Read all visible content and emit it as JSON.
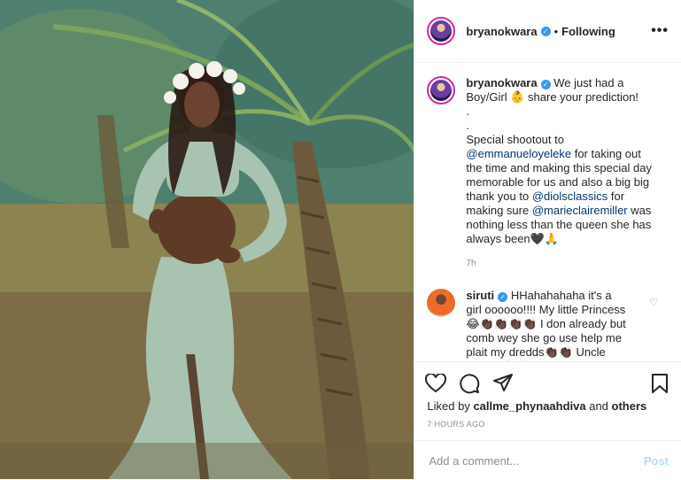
{
  "header": {
    "username": "bryanokwara",
    "separator": "•",
    "follow_state": "Following",
    "more": "•••"
  },
  "caption": {
    "username": "bryanokwara",
    "line1": "We just had a Boy/Girl 👶 share your prediction!",
    "dots": ".",
    "dots2": ".",
    "text_a": "Special shootout to ",
    "mention1": "@emmanueloyeleke",
    "text_b": " for taking out the time and making this special day memorable for us and also a big big thank you to ",
    "mention2": "@diolsclassics",
    "text_c": " for making sure ",
    "mention3": "@marieclairemiller",
    "text_d": " was nothing less than the queen she has always been🖤🙏",
    "time": "7h"
  },
  "comment": {
    "username": "siruti",
    "text": "HHahahahaha it's a girl oooooo!!!! My little Princess😂👏🏿👏🏿👏🏿👏🏿 I don already but comb wey she go use help me plait my dredds👏🏿👏🏿 Uncle Utiiiiiiii👏🏿👏🏿"
  },
  "likes": {
    "prefix": "Liked by ",
    "user": "callme_phynaahdiva",
    "and": " and ",
    "others": "others"
  },
  "posted_ago": "7 HOURS AGO",
  "comment_box": {
    "placeholder": "Add a comment...",
    "post_label": "Post"
  },
  "colors": {
    "accent_blue": "#3897f0",
    "mention": "#00376b",
    "muted": "#8e8e8e",
    "post_disabled": "#b2dffc"
  }
}
